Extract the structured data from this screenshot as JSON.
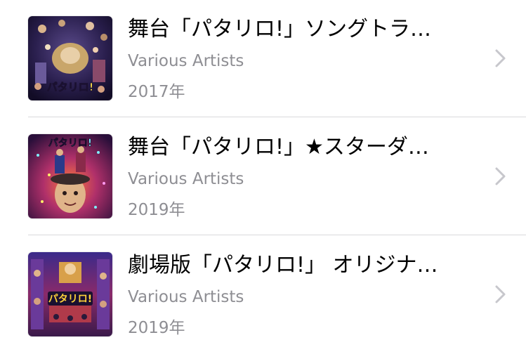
{
  "albums": [
    {
      "title": "舞台「パタリロ!」ソングトラ…",
      "artist": "Various Artists",
      "year": "2017年",
      "artwork": {
        "logo_text": "パタリロ!"
      }
    },
    {
      "title": "舞台「パタリロ!」★スターダ…",
      "artist": "Various Artists",
      "year": "2019年",
      "artwork": {
        "logo_text": "パタリロ!"
      }
    },
    {
      "title": "劇場版「パタリロ!」 オリジナ…",
      "artist": "Various Artists",
      "year": "2019年",
      "artwork": {
        "logo_text": "パタリロ!"
      }
    }
  ],
  "icons": {
    "disclosure": "chevron-right-icon"
  },
  "colors": {
    "primary_text": "#000000",
    "secondary_text": "#8e8e93",
    "chevron": "#c7c7cc",
    "separator": "#d8d8dc"
  }
}
